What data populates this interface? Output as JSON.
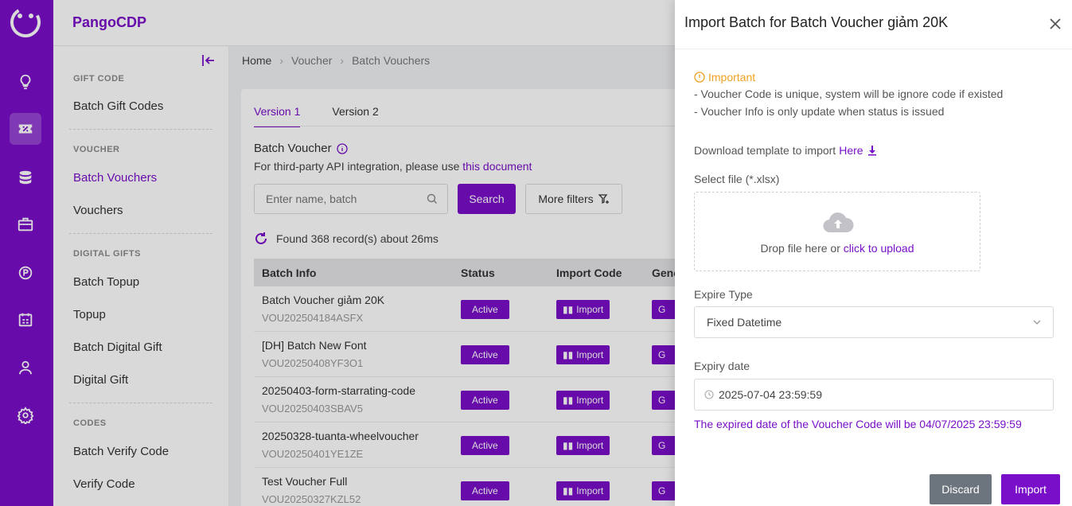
{
  "brand": "PangoCDP",
  "breadcrumb": [
    "Home",
    "Voucher",
    "Batch Vouchers"
  ],
  "sidenav": {
    "sections": [
      {
        "title": "GIFT CODE",
        "items": [
          "Batch Gift Codes"
        ]
      },
      {
        "title": "VOUCHER",
        "items": [
          "Batch Vouchers",
          "Vouchers"
        ]
      },
      {
        "title": "DIGITAL GIFTS",
        "items": [
          "Batch Topup",
          "Topup",
          "Batch Digital Gift",
          "Digital Gift"
        ]
      },
      {
        "title": "CODES",
        "items": [
          "Batch Verify Code",
          "Verify Code"
        ]
      }
    ],
    "active_item": "Batch Vouchers"
  },
  "rail_icons": [
    "lightbulb-icon",
    "voucher-icon",
    "database-icon",
    "briefcase-icon",
    "gear-p-icon",
    "calendar-icon",
    "user-icon",
    "settings-icon"
  ],
  "main": {
    "tabs": [
      "Version 1",
      "Version 2"
    ],
    "active_tab": "Version 1",
    "title": "Batch Voucher",
    "desc_prefix": "For third-party API integration, please use",
    "desc_link": "this document",
    "search_placeholder": "Enter name, batch",
    "search_label": "Search",
    "filters_label": "More filters",
    "found_text": "Found 368 record(s) about 26ms",
    "columns": [
      "Batch Info",
      "Status",
      "Import Code",
      "Gene"
    ],
    "rows": [
      {
        "name": "Batch Voucher giảm 20K",
        "code": "VOU202504184ASFX",
        "status": "Active",
        "import": "Import",
        "gen": "G"
      },
      {
        "name": "[DH] Batch New Font",
        "code": "VOU20250408YF3O1",
        "status": "Active",
        "import": "Import",
        "gen": "G"
      },
      {
        "name": "20250403-form-starrating-code",
        "code": "VOU20250403SBAV5",
        "status": "Active",
        "import": "Import",
        "gen": "G"
      },
      {
        "name": "20250328-tuanta-wheelvoucher",
        "code": "VOU20250401YE1ZE",
        "status": "Active",
        "import": "Import",
        "gen": "G"
      },
      {
        "name": "Test Voucher Full",
        "code": "VOU20250327KZL52",
        "status": "Active",
        "import": "Import",
        "gen": "G"
      }
    ]
  },
  "drawer": {
    "title": "Import Batch for Batch Voucher giảm 20K",
    "important_title": "Important",
    "important_lines": [
      "- Voucher Code is unique, system will be ignore code if existed",
      "- Voucher Info is only update when status is issued"
    ],
    "download_text": "Download template to import",
    "download_link": "Here",
    "select_file_label": "Select file (*.xlsx)",
    "drop_text": "Drop file here or",
    "drop_link": "click to upload",
    "expire_type_label": "Expire Type",
    "expire_type_value": "Fixed Datetime",
    "expiry_date_label": "Expiry date",
    "expiry_date_value": "2025-07-04 23:59:59",
    "note": "The expired date of the Voucher Code will be 04/07/2025 23:59:59",
    "discard_label": "Discard",
    "import_label": "Import"
  },
  "colors": {
    "accent": "#7a0fc9",
    "warning": "#f0a020",
    "discard": "#6c757d"
  }
}
